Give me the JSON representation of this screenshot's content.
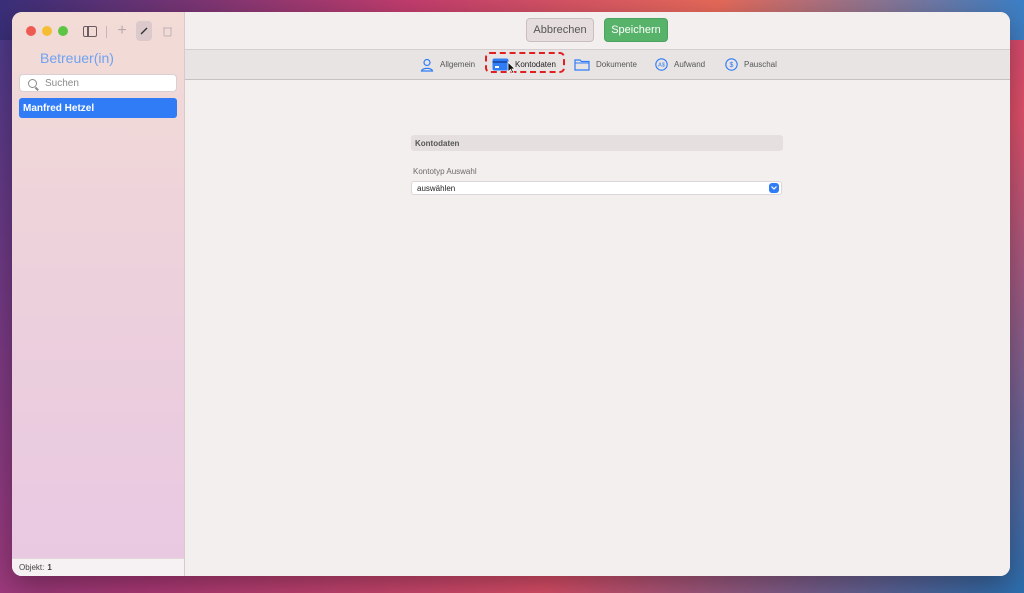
{
  "window": {
    "toolbar": {
      "cancel_label": "Abbrechen",
      "save_label": "Speichern"
    }
  },
  "sidebar": {
    "title": "Betreuer(in)",
    "search_placeholder": "Suchen",
    "items": [
      {
        "label": "Manfred Hetzel",
        "selected": true
      }
    ],
    "footer_label": "Objekt:",
    "footer_count": "1"
  },
  "tabs": [
    {
      "label": "Allgemein",
      "icon": "person-icon"
    },
    {
      "label": "Kontodaten",
      "icon": "credit-card-icon",
      "active": true
    },
    {
      "label": "Dokumente",
      "icon": "folder-icon"
    },
    {
      "label": "Aufwand",
      "icon": "currency-badge-icon"
    },
    {
      "label": "Pauschal",
      "icon": "dollar-circle-icon"
    }
  ],
  "form": {
    "section_title": "Kontodaten",
    "field_label": "Kontotyp Auswahl",
    "select_value": "auswählen"
  },
  "colors": {
    "accent": "#2f7cf6",
    "save_button": "#57b26a",
    "highlight": "#e02020"
  }
}
